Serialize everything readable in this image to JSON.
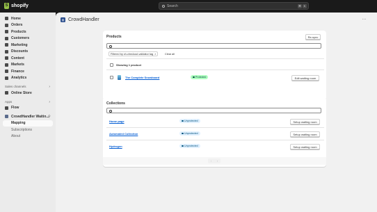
{
  "topbar": {
    "logo_text": "shopify",
    "search_placeholder": "Search",
    "shortcut_key1": "⌘",
    "shortcut_key2": "K"
  },
  "sidebar": {
    "items": [
      {
        "label": "Home",
        "icon": "home-icon"
      },
      {
        "label": "Orders",
        "icon": "orders-icon"
      },
      {
        "label": "Products",
        "icon": "products-icon"
      },
      {
        "label": "Customers",
        "icon": "customers-icon"
      },
      {
        "label": "Marketing",
        "icon": "marketing-icon"
      },
      {
        "label": "Discounts",
        "icon": "discounts-icon"
      },
      {
        "label": "Content",
        "icon": "content-icon"
      },
      {
        "label": "Markets",
        "icon": "markets-icon"
      },
      {
        "label": "Finance",
        "icon": "finance-icon"
      },
      {
        "label": "Analytics",
        "icon": "analytics-icon"
      }
    ],
    "sales_channels_label": "Sales channels",
    "online_store_label": "Online Store",
    "apps_label": "Apps",
    "flow_label": "Flow",
    "app_name": "CrowdHandler Waitin...",
    "app_subitems": [
      "Mapping",
      "Subscriptions",
      "About"
    ],
    "active_subitem": "Mapping"
  },
  "header": {
    "app_title": "CrowdHandler",
    "more_label": "···"
  },
  "products_card": {
    "title": "Products",
    "resync_label": "Re-sync",
    "filter_chip": "Filtered by ch-checkout-validator tag",
    "clear_all": "Clear all",
    "showing": "Showing 1 product",
    "rows": [
      {
        "name": "The Complete Snowboard",
        "status": "Protected",
        "action": "Edit waiting room"
      }
    ]
  },
  "collections_card": {
    "title": "Collections",
    "rows": [
      {
        "name": "Home page",
        "status": "Unprotected",
        "action": "Setup waiting room"
      },
      {
        "name": "Automated Collection",
        "status": "Unprotected",
        "action": "Setup waiting room"
      },
      {
        "name": "Hydrogen",
        "status": "Unprotected",
        "action": "Setup waiting room"
      }
    ]
  },
  "pagination": {
    "prev": "‹",
    "next": "›"
  },
  "colors": {
    "accent_link": "#005bd3",
    "protected_badge": "#affebf",
    "unprotected_badge": "#e0f0ff",
    "sidebar_bg": "#ebebeb",
    "topbar_bg": "#1a1a1a"
  }
}
